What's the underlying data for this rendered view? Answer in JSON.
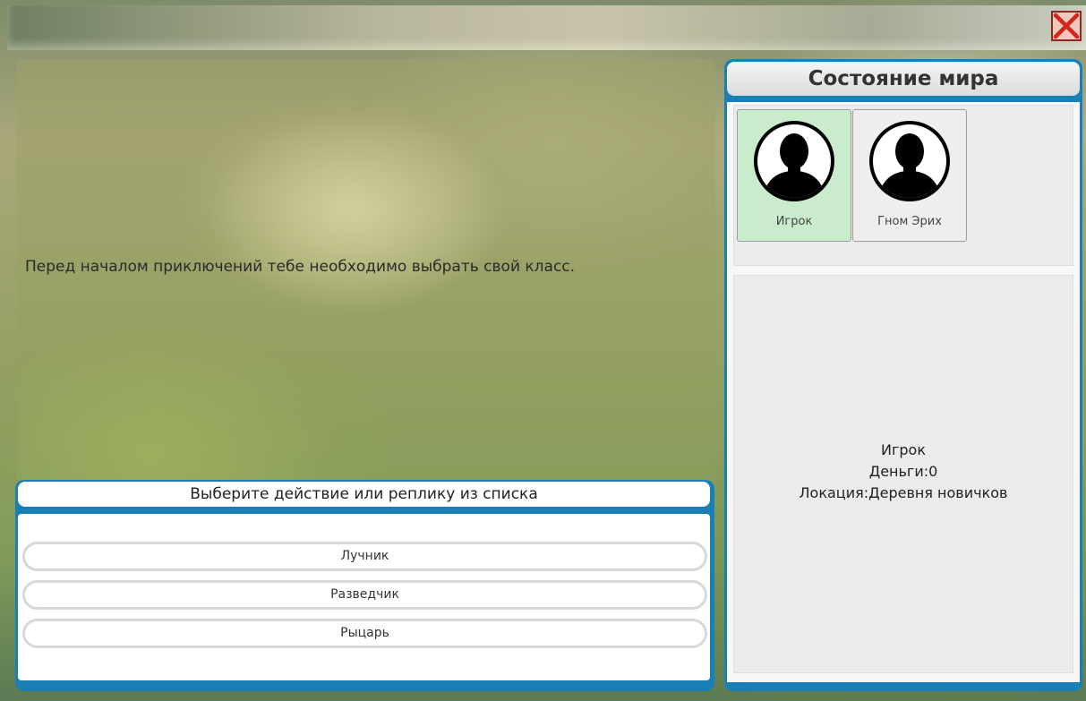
{
  "story": {
    "text": "Перед началом приключений тебе необходимо выбрать свой класс."
  },
  "actions": {
    "header": "Выберите действие или реплику из списка",
    "choices": [
      {
        "label": "Лучник"
      },
      {
        "label": "Разведчик"
      },
      {
        "label": "Рыцарь"
      }
    ]
  },
  "world": {
    "title": "Состояние мира",
    "characters": [
      {
        "name": "Игрок",
        "avatar": "person-silhouette-icon",
        "selected": true
      },
      {
        "name": "Гном Эрих",
        "avatar": "person-silhouette-icon",
        "selected": false
      }
    ],
    "info": {
      "name": "Игрок",
      "money_label": "Деньги:",
      "money": "0",
      "location_label": "Локация:",
      "location": "Деревня новичков"
    }
  },
  "icons": {
    "close": "close-icon"
  },
  "colors": {
    "panel_frame": "#1a7fb5",
    "selected_card": "#c9eccd",
    "close_border": "#8a2a20"
  }
}
